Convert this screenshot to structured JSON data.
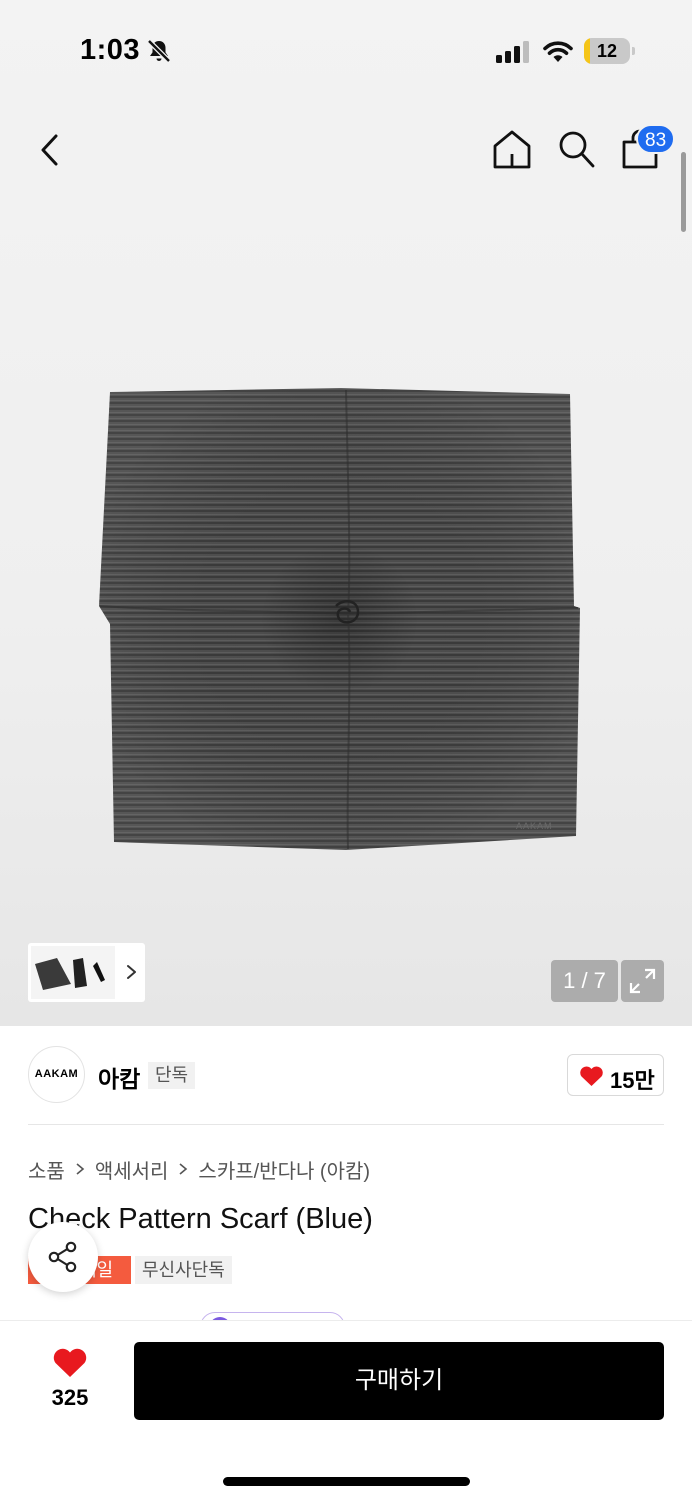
{
  "status_bar": {
    "time": "1:03",
    "battery_level": "12",
    "battery_fraction": 0.12,
    "battery_color": "#f5c518",
    "icons": [
      "bell-off-icon",
      "signal-icon",
      "wifi-icon",
      "battery-icon"
    ]
  },
  "header": {
    "icons": [
      "back-icon",
      "home-icon",
      "search-icon",
      "shopping-bag-icon"
    ],
    "cart_count": "83",
    "badge_color": "#1f6cf0"
  },
  "gallery": {
    "page_counter": "1 / 7",
    "watermark": "AAKAM"
  },
  "brand": {
    "logo_text": "AAKAM",
    "name": "아캄",
    "tag": "단독",
    "like_count": "15만",
    "heart_color": "#e8191f"
  },
  "breadcrumb": [
    "소품",
    "액세서리",
    "스카프/반다나 (아캄)"
  ],
  "product": {
    "title": "Check Pattern Scarf (Blue)",
    "tags": {
      "sale": "세일",
      "musinsa": "무신사단독"
    },
    "sale_color": "#f45b3e"
  },
  "bottom_bar": {
    "wish_count": "325",
    "buy_label": "구매하기"
  }
}
